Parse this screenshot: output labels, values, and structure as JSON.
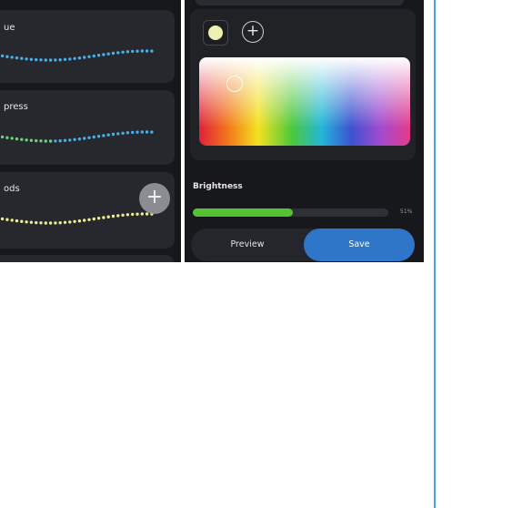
{
  "presets": [
    {
      "label": "ue"
    },
    {
      "label": "press"
    },
    {
      "label": "ods"
    }
  ],
  "add_preset_symbol": "+",
  "add_color_symbol": "+",
  "color_picker": {
    "selected_swatch_color": "#eef0b2"
  },
  "brightness": {
    "label": "Brightness",
    "percent": 51,
    "value_text": "51%"
  },
  "buttons": {
    "preview": "Preview",
    "save": "Save"
  },
  "colors": {
    "panel_background": "#17181c",
    "card_background": "#26282d",
    "accent_blue": "#2f76c8",
    "brightness_green": "#54c232",
    "divider_blue": "#4aa3e8",
    "dot_blue": "#46aee8",
    "dot_green": "#6bd07a",
    "dot_yellow": "#ecec90"
  }
}
